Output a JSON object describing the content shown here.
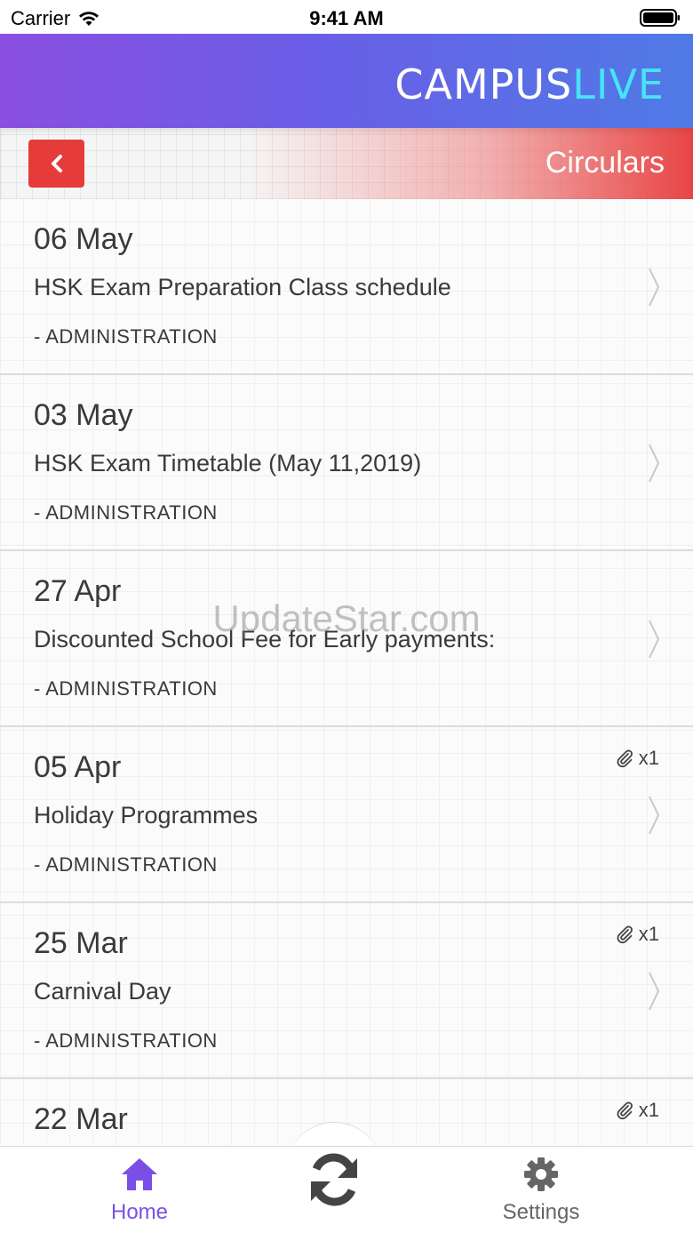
{
  "status_bar": {
    "carrier": "Carrier",
    "time": "9:41 AM"
  },
  "header": {
    "logo_part1": "CAMPUS",
    "logo_part2": "LIVE"
  },
  "subheader": {
    "title": "Circulars"
  },
  "circulars": [
    {
      "date": "06 May",
      "title": "HSK Exam Preparation Class schedule",
      "dept": "- ADMINISTRATION",
      "attachment": ""
    },
    {
      "date": "03 May",
      "title": "HSK Exam Timetable (May 11,2019)",
      "dept": "- ADMINISTRATION",
      "attachment": ""
    },
    {
      "date": "27 Apr",
      "title": "Discounted School Fee for Early payments:",
      "dept": "- ADMINISTRATION",
      "attachment": ""
    },
    {
      "date": "05 Apr",
      "title": "Holiday Programmes",
      "dept": "- ADMINISTRATION",
      "attachment": "x1"
    },
    {
      "date": "25 Mar",
      "title": "Carnival Day",
      "dept": "- ADMINISTRATION",
      "attachment": "x1"
    },
    {
      "date": "22 Mar",
      "title": "",
      "dept": "",
      "attachment": "x1"
    }
  ],
  "watermark": "UpdateStar.com",
  "tabs": {
    "home": "Home",
    "settings": "Settings"
  },
  "colors": {
    "accent_purple": "#7b4fe6",
    "back_button_red": "#e53b3b",
    "logo_live_cyan": "#47e3f7"
  },
  "icons": {
    "back": "chevron-left-icon",
    "row": "chevron-right-icon",
    "attachment": "paperclip-icon",
    "home": "home-icon",
    "refresh": "refresh-icon",
    "settings": "gear-icon"
  }
}
